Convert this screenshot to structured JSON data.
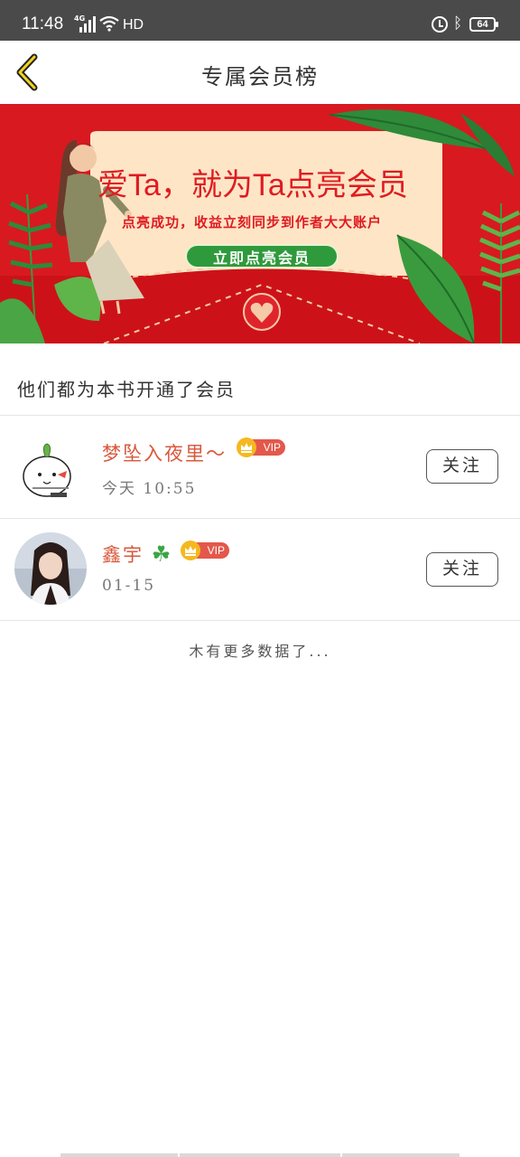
{
  "status_bar": {
    "time": "11:48",
    "network": "4G",
    "hd": "HD",
    "battery": "64"
  },
  "header": {
    "title": "专属会员榜"
  },
  "banner": {
    "headline": "爱Ta，就为Ta点亮会员",
    "subtitle": "点亮成功，收益立刻同步到作者大大账户",
    "button_label": "立即点亮会员"
  },
  "section": {
    "title": "他们都为本书开通了会员"
  },
  "members": [
    {
      "name": "梦坠入夜里～",
      "vip_label": "VIP",
      "time": "今天 10:55",
      "follow_label": "关注"
    },
    {
      "name": "鑫宇",
      "vip_label": "VIP",
      "time": "01-15",
      "follow_label": "关注"
    }
  ],
  "footer": {
    "no_more": "木有更多数据了..."
  },
  "colors": {
    "banner_red": "#d81920",
    "name_color": "#d9583b",
    "vip_pill": "#e3584b",
    "crown": "#f5b820",
    "button_green": "#2f9a3c"
  }
}
